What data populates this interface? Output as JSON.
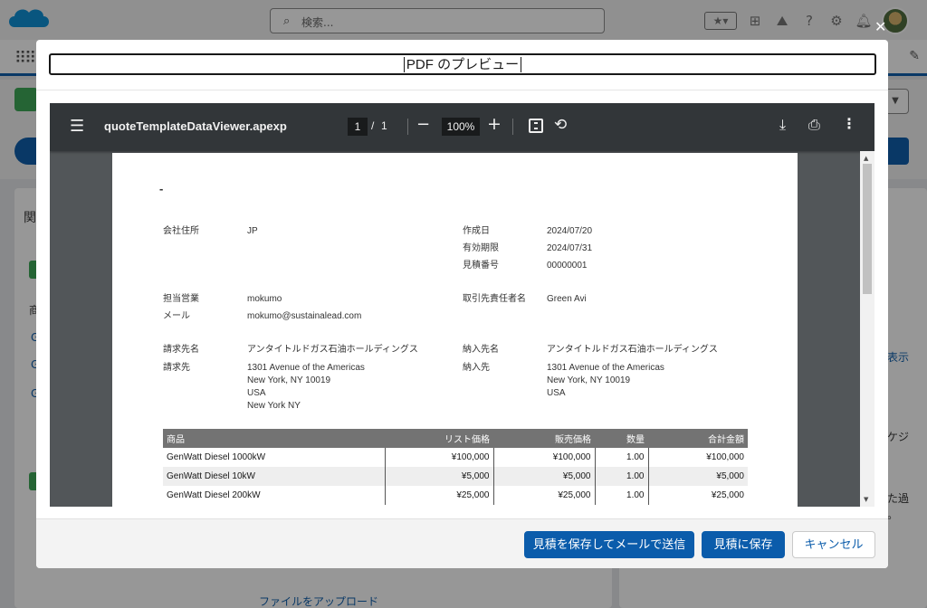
{
  "background": {
    "search_placeholder": "検索...",
    "right_fragments": [
      "表示",
      "ケジ",
      "た過",
      "。"
    ],
    "left_fragments": [
      "関",
      "商",
      "G",
      "G",
      "G"
    ],
    "upload_label": "ファイルをアップロード"
  },
  "modal": {
    "title": "PDF のプレビュー",
    "close_icon": "close-icon"
  },
  "viewer": {
    "filename": "quoteTemplateDataViewer.apexp",
    "current_page": "1",
    "page_separator": "/",
    "total_pages": "1",
    "zoom": "100%",
    "colors": {
      "toolbar": "#323639",
      "canvas": "#525659"
    }
  },
  "document": {
    "heading": "-",
    "company_address_label": "会社住所",
    "company_address_value": "JP",
    "created_label": "作成日",
    "created_value": "2024/07/20",
    "expiry_label": "有効期限",
    "expiry_value": "2024/07/31",
    "quote_no_label": "見積番号",
    "quote_no_value": "00000001",
    "sales_rep_label": "担当営業",
    "sales_rep_value": "mokumo",
    "contact_label": "取引先責任者名",
    "contact_value": "Green Avi",
    "email_label": "メール",
    "email_value": "mokumo@sustainalead.com",
    "bill_to_name_label": "請求先名",
    "bill_to_name_value": "アンタイトルドガス石油ホールディングス",
    "ship_to_name_label": "納入先名",
    "ship_to_name_value": "アンタイトルドガス石油ホールディングス",
    "bill_to_label": "請求先",
    "bill_to_lines": [
      "1301 Avenue of the Americas",
      "New York, NY 10019",
      "USA",
      "New York NY"
    ],
    "ship_to_label": "納入先",
    "ship_to_lines": [
      "1301 Avenue of the Americas",
      "New York, NY 10019",
      "USA"
    ],
    "table": {
      "headers": [
        "商品",
        "リスト価格",
        "販売価格",
        "数量",
        "合計金額"
      ],
      "rows": [
        [
          "GenWatt Diesel 1000kW",
          "¥100,000",
          "¥100,000",
          "1.00",
          "¥100,000"
        ],
        [
          "GenWatt Diesel 10kW",
          "¥5,000",
          "¥5,000",
          "1.00",
          "¥5,000"
        ],
        [
          "GenWatt Diesel 200kW",
          "¥25,000",
          "¥25,000",
          "1.00",
          "¥25,000"
        ]
      ]
    }
  },
  "footer": {
    "save_and_email": "見積を保存してメールで送信",
    "save": "見積に保存",
    "cancel": "キャンセル"
  }
}
